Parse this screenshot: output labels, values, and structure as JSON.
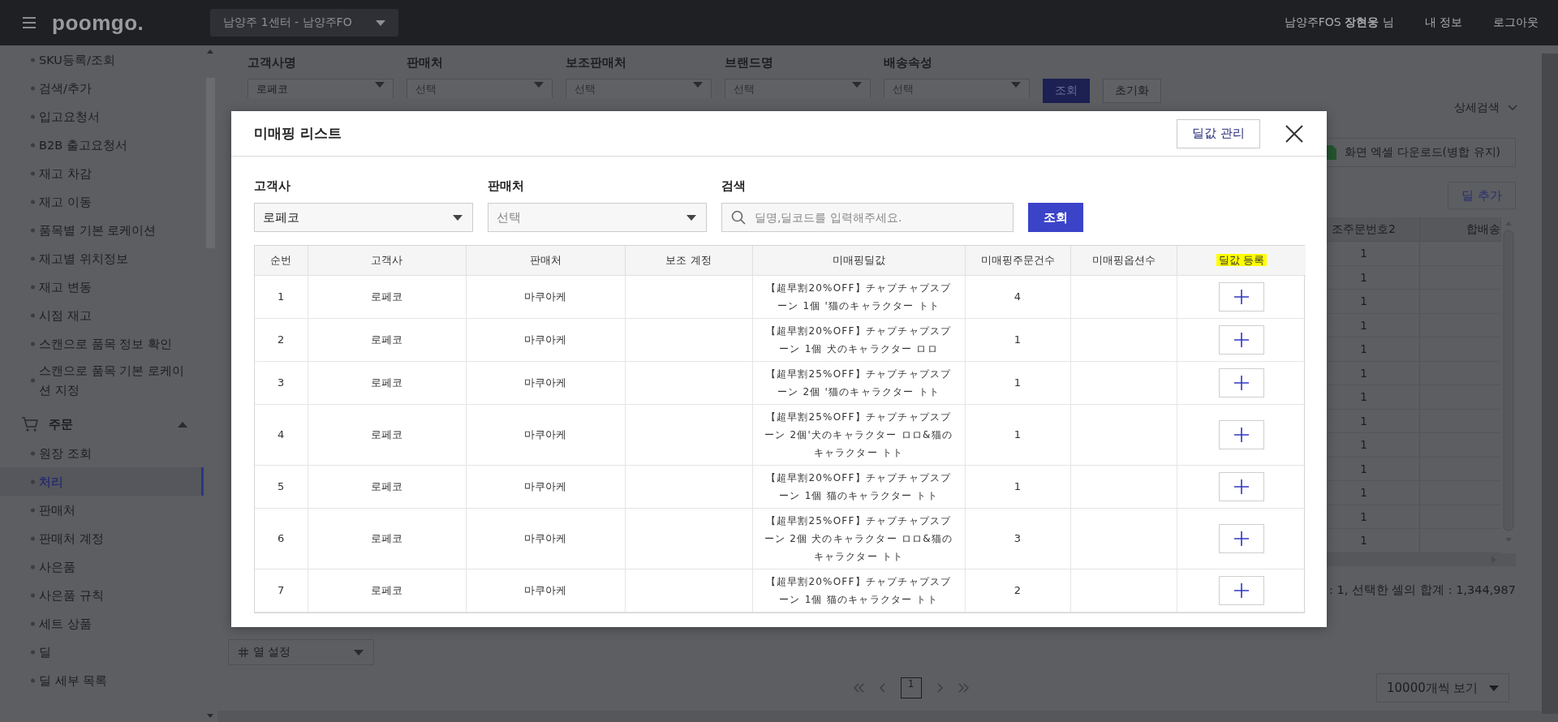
{
  "top_bar": {
    "logo": "poomgo.",
    "center_select": "남양주 1센터 - 남양주FO",
    "user": "남양주FOS **장현웅** 님",
    "links": [
      "내 정보",
      "로그아웃"
    ]
  },
  "sidebar": {
    "items": [
      {
        "label": "SKU등록/조회",
        "selected": false
      },
      {
        "label": "검색/추가",
        "selected": false
      },
      {
        "label": "입고요청서",
        "selected": false
      },
      {
        "label": "B2B 출고요청서",
        "selected": false
      },
      {
        "label": "재고 차감",
        "selected": false
      },
      {
        "label": "재고 이동",
        "selected": false
      },
      {
        "label": "품목별 기본 로케이션",
        "selected": false
      },
      {
        "label": "재고별 위치정보",
        "selected": false
      },
      {
        "label": "재고 변동",
        "selected": false
      },
      {
        "label": "시점 재고",
        "selected": false
      },
      {
        "label": "스캔으로 품목 정보 확인",
        "selected": false
      },
      {
        "label": "스캔으로 품목 기본 로케이션 지정",
        "selected": false
      }
    ],
    "sections": [
      {
        "label": "주문",
        "expanded": true,
        "items": [
          {
            "label": "원장 조회",
            "selected": false
          },
          {
            "label": "처리",
            "selected": true
          },
          {
            "label": "판매처",
            "selected": false
          },
          {
            "label": "판매처 계정",
            "selected": false
          },
          {
            "label": "사은품",
            "selected": false
          },
          {
            "label": "사은품 규칙",
            "selected": false
          },
          {
            "label": "세트 상품",
            "selected": false
          },
          {
            "label": "딜",
            "selected": false
          },
          {
            "label": "딜 세부 목록",
            "selected": false
          }
        ]
      }
    ]
  },
  "filters": [
    {
      "label": "고객사명",
      "value": "로페코"
    },
    {
      "label": "판매처",
      "placeholder": "선택"
    },
    {
      "label": "보조판매처",
      "placeholder": "선택"
    },
    {
      "label": "브랜드명",
      "placeholder": "선택"
    },
    {
      "label": "배송속성",
      "placeholder": "선택"
    }
  ],
  "filter_buttons": [
    {
      "label": "조회",
      "kind": "primary"
    },
    {
      "label": "초기화",
      "kind": "secondary"
    }
  ],
  "detail_search": "상세검색",
  "excel_button": "화면 엑셀 다운로드(병합 유지)",
  "add_deal_button": "딜 추가",
  "grid": {
    "columns": [
      "조주문번호2",
      "합배송"
    ],
    "rows": [
      "1",
      "1",
      "1",
      "1",
      "1",
      "1",
      "1",
      "1",
      "1",
      "1",
      "1",
      "1",
      "1"
    ]
  },
  "status": ": 1, 선택한 셀의 합계 : 1,344,987",
  "column_settings": "열 설정",
  "pager": {
    "pages": [
      {
        "label": "1",
        "selected": true
      }
    ]
  },
  "page_size": "10000개씩 보기",
  "modal": {
    "title": "미매핑 리스트",
    "manage_button": "딜값 관리",
    "filters": [
      {
        "label": "고객사",
        "kind": "select",
        "value": "로페코"
      },
      {
        "label": "판매처",
        "kind": "select",
        "placeholder": "선택"
      },
      {
        "label": "검색",
        "kind": "search",
        "placeholder": "딜명,딜코드를 입력해주세요."
      }
    ],
    "search_button": "조회",
    "table": {
      "columns": [
        {
          "label": "순번",
          "highlighted": false
        },
        {
          "label": "고객사",
          "highlighted": false
        },
        {
          "label": "판매처",
          "highlighted": false
        },
        {
          "label": "보조 계정",
          "highlighted": false
        },
        {
          "label": "미매핑딜값",
          "highlighted": false
        },
        {
          "label": "미매핑주문건수",
          "highlighted": false
        },
        {
          "label": "미매핑옵션수",
          "highlighted": false
        },
        {
          "label": "딜값 등록",
          "highlighted": true
        }
      ],
      "rows": [
        {
          "no": "1",
          "customer": "로페코",
          "seller": "마쿠아케",
          "deal": "【超早割20%OFF】チャプチャプスプーン 1個 '猫のキャラクター トト",
          "orders": "4"
        },
        {
          "no": "2",
          "customer": "로페코",
          "seller": "마쿠아케",
          "deal": "【超早割20%OFF】チャプチャプスプーン 1個 犬のキャラクター ロロ",
          "orders": "1"
        },
        {
          "no": "3",
          "customer": "로페코",
          "seller": "마쿠아케",
          "deal": "【超早割25%OFF】チャプチャプスプーン 2個 '猫のキャラクター トト",
          "orders": "1"
        },
        {
          "no": "4",
          "customer": "로페코",
          "seller": "마쿠아케",
          "deal": "【超早割25%OFF】チャプチャプスプーン 2個'犬のキャラクター ロロ&猫のキャラクター トト",
          "orders": "1"
        },
        {
          "no": "5",
          "customer": "로페코",
          "seller": "마쿠아케",
          "deal": "【超早割20%OFF】チャプチャプスプーン 1個 猫のキャラクター トト",
          "orders": "1"
        },
        {
          "no": "6",
          "customer": "로페코",
          "seller": "마쿠아케",
          "deal": "【超早割25%OFF】チャプチャプスプーン 2個 犬のキャラクター ロロ&猫のキャラクター トト",
          "orders": "3"
        },
        {
          "no": "7",
          "customer": "로페코",
          "seller": "마쿠아케",
          "deal": "【超早割20%OFF】チャプチャプスプーン 1個 猫のキャラクター トト",
          "orders": "2"
        }
      ]
    }
  }
}
